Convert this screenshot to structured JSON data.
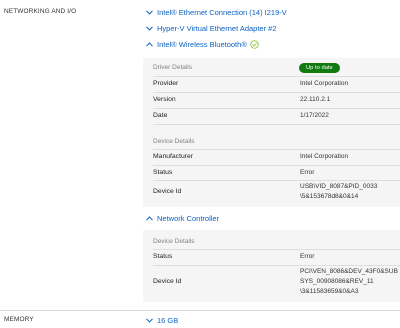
{
  "sections": {
    "networking_label": "NETWORKING AND I/O",
    "memory_label": "MEMORY",
    "memory_value": "16 GB"
  },
  "devices": [
    {
      "name": "Intel® Ethernet Connection (14) I219-V"
    },
    {
      "name": "Hyper-V Virtual Ethernet Adapter #2"
    },
    {
      "name": "Intel® Wireless Bluetooth®"
    },
    {
      "name": "Network Controller"
    }
  ],
  "bluetooth": {
    "driver_title": "Driver Details",
    "driver_status_badge": "Up to date",
    "driver_rows": [
      {
        "key": "Provider",
        "value": "Intel Corporation"
      },
      {
        "key": "Version",
        "value": "22.110.2.1"
      },
      {
        "key": "Date",
        "value": "1/17/2022"
      }
    ],
    "device_title": "Device Details",
    "device_rows": [
      {
        "key": "Manufacturer",
        "value": "Intel Corporation"
      },
      {
        "key": "Status",
        "value": "Error"
      },
      {
        "key": "Device Id",
        "value_line1": "USB\\VID_8087&PID_0033",
        "value_line2": "\\5&153678d8&0&14"
      }
    ]
  },
  "network_controller": {
    "device_title": "Device Details",
    "device_rows": [
      {
        "key": "Status",
        "value": "Error"
      },
      {
        "key": "Device Id",
        "value_line1": "PCI\\VEN_8086&DEV_43F0&SUB",
        "value_line2": "SYS_00908086&REV_11",
        "value_line3": "\\3&11583659&0&A3"
      }
    ]
  },
  "colors": {
    "link": "#0b63c1",
    "badge_green": "#107c10",
    "panel_bg": "#f5f5f5",
    "ok_check": "#8cbf26"
  },
  "icons": {
    "chevron": "chevron-down-icon",
    "ok": "check-circle-icon"
  }
}
